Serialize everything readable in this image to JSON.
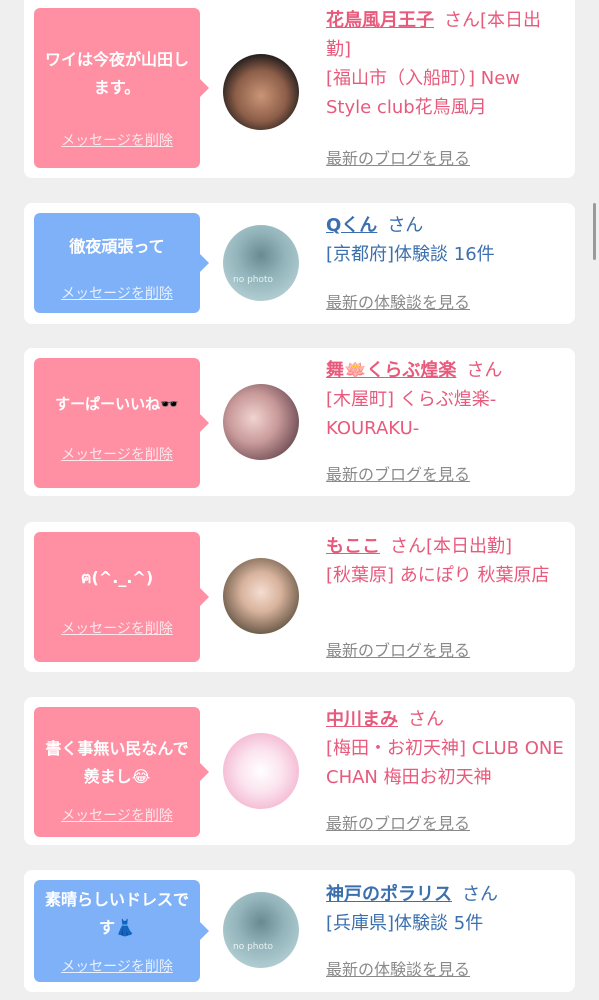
{
  "cards": [
    {
      "message": "ワイは今夜が山田します。",
      "delete_label": "メッセージを削除",
      "name": "花鳥風月王子",
      "honorific": "さん",
      "extra": "[本日出勤]",
      "detail": "[福山市（入船町）] New Style club花鳥風月",
      "link": "最新のブログを見る",
      "bubble": "pink"
    },
    {
      "message": "徹夜頑張って",
      "delete_label": "メッセージを削除",
      "name": "Qくん",
      "honorific": "さん",
      "extra": "",
      "detail": "[京都府]体験談 16件",
      "link": "最新の体験談を見る",
      "no_photo": "no photo",
      "bubble": "blue"
    },
    {
      "message": "すーぱーいいね🕶️",
      "delete_label": "メッセージを削除",
      "name": "舞🪷くらぶ煌楽",
      "honorific": "さん",
      "extra": "",
      "detail": "[木屋町] くらぶ煌楽-KOURAKU-",
      "link": "最新のブログを見る",
      "bubble": "pink"
    },
    {
      "message": "ฅ(^._.^)",
      "delete_label": "メッセージを削除",
      "name": "もここ",
      "honorific": "さん",
      "extra": "[本日出勤]",
      "detail": "[秋葉原] あにぽり 秋葉原店",
      "link": "最新のブログを見る",
      "bubble": "pink"
    },
    {
      "message": "書く事無い民なんで羨まし😂",
      "delete_label": "メッセージを削除",
      "name": "中川まみ",
      "honorific": "さん",
      "extra": "",
      "detail": "[梅田・お初天神] CLUB ONE CHAN 梅田お初天神",
      "link": "最新のブログを見る",
      "bubble": "pink"
    },
    {
      "message": "素晴らしいドレスです👗",
      "delete_label": "メッセージを削除",
      "name": "神戸のポラリス",
      "honorific": "さん",
      "extra": "",
      "detail": "[兵庫県]体験談 5件",
      "link": "最新の体験談を見る",
      "no_photo": "no photo",
      "bubble": "blue"
    }
  ]
}
